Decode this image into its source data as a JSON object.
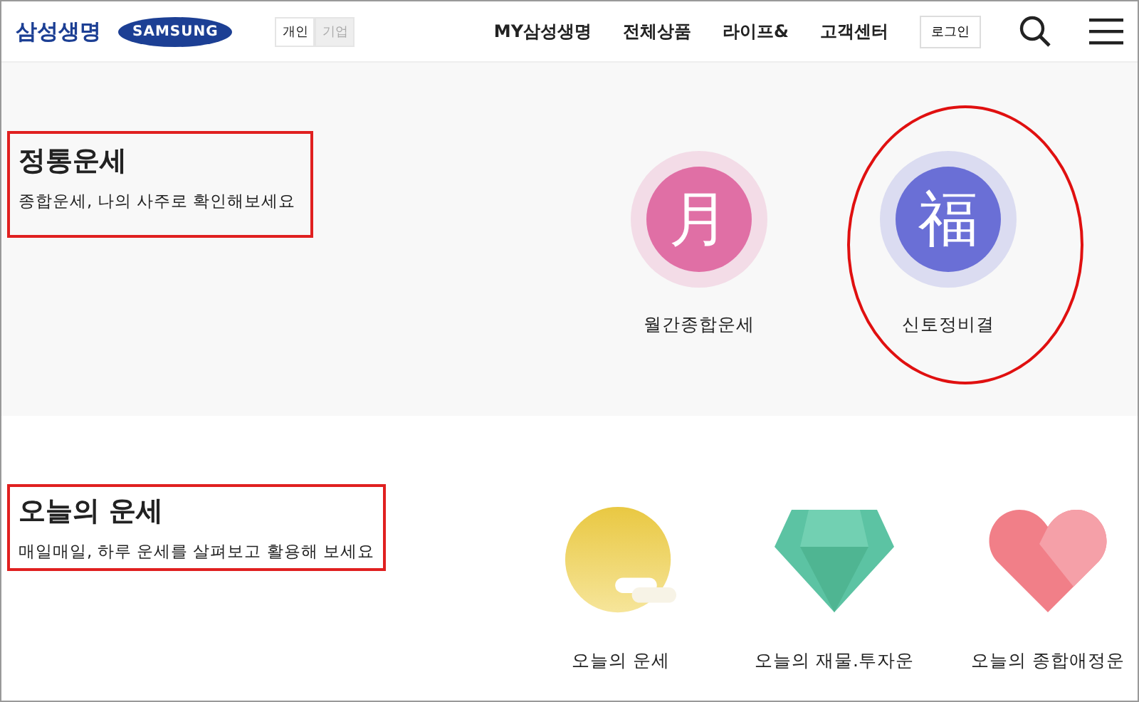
{
  "header": {
    "brand": "삼성생명",
    "logo": "SAMSUNG",
    "tabs": [
      {
        "label": "개인",
        "selected": true
      },
      {
        "label": "기업",
        "selected": false
      }
    ],
    "nav": [
      "MY삼성생명",
      "전체상품",
      "라이프&",
      "고객센터"
    ],
    "login": "로그인"
  },
  "sections": [
    {
      "title": "정통운세",
      "subtitle": "종합운세, 나의 사주로 확인해보세요",
      "items": [
        {
          "kind": "glyph",
          "glyph": "月",
          "color": "#e06fa5",
          "label": "월간종합운세",
          "circled": false
        },
        {
          "kind": "glyph",
          "glyph": "福",
          "color": "#6a6fd6",
          "label": "신토정비결",
          "circled": true
        }
      ]
    },
    {
      "title": "오늘의 운세",
      "subtitle": "매일매일, 하루 운세를 살펴보고 활용해 보세요",
      "items": [
        {
          "kind": "sun",
          "label": "오늘의 운세",
          "circled": false
        },
        {
          "kind": "gem",
          "label": "오늘의 재물.투자운",
          "circled": false
        },
        {
          "kind": "heart",
          "label": "오늘의 종합애정운",
          "circled": false
        }
      ]
    }
  ]
}
